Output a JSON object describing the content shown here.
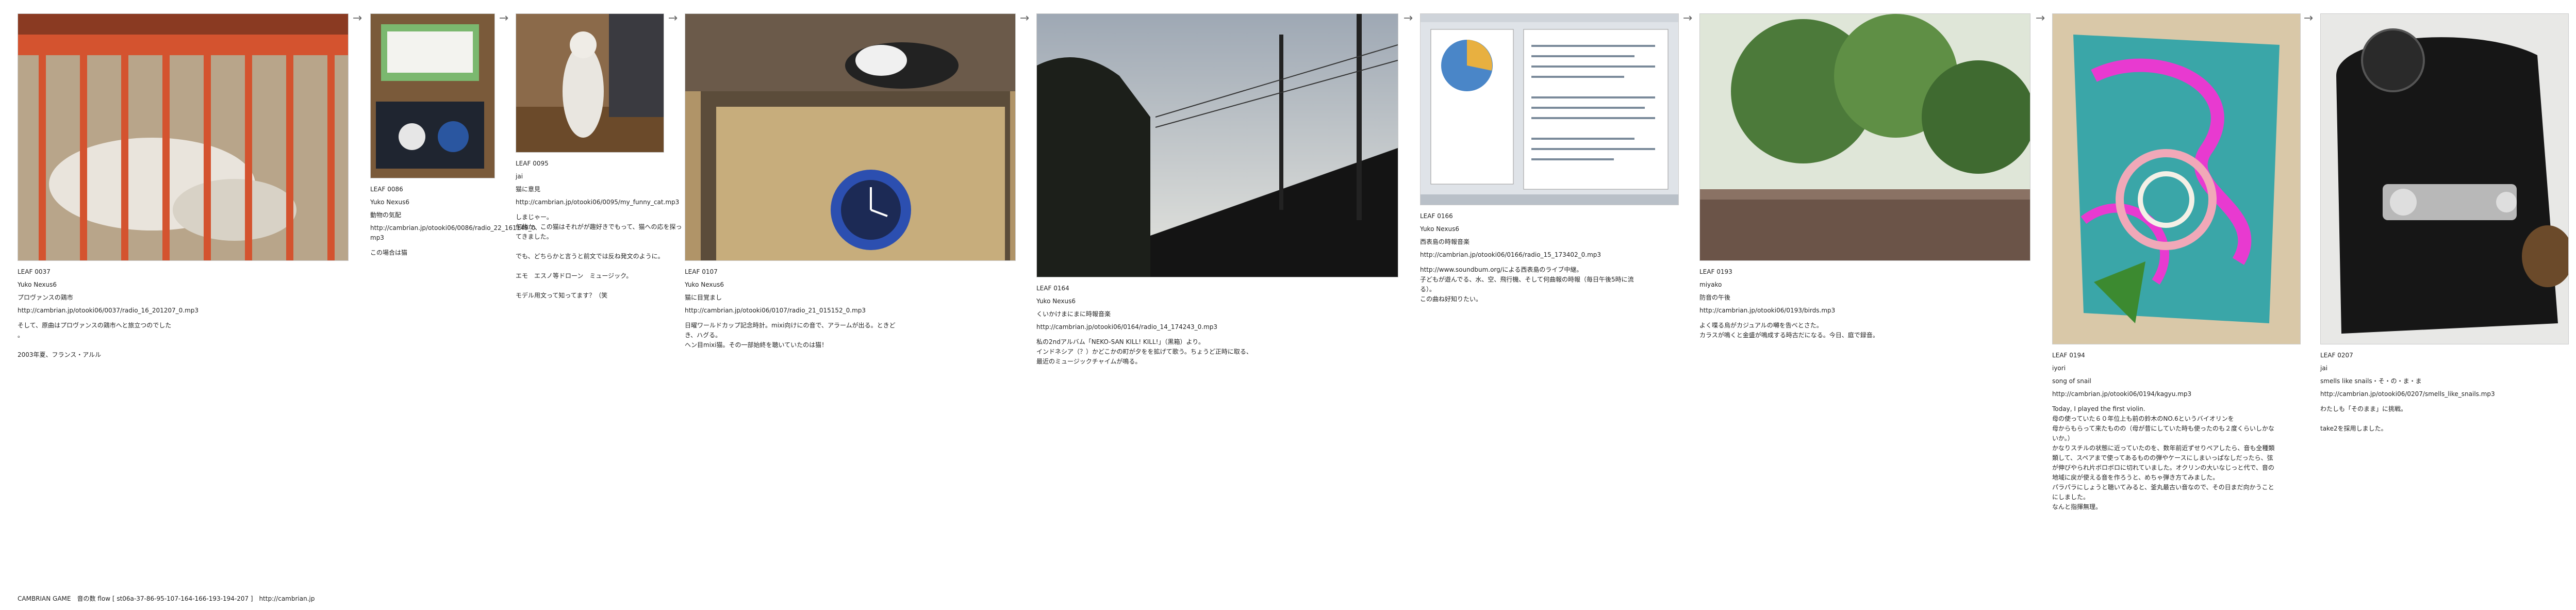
{
  "footer": {
    "label": "CAMBRIAN GAME　音の数  flow [ st06a-37-86-95-107-164-166-193-194-207 ]",
    "link": "http://cambrian.jp"
  },
  "arrow": "→",
  "leaves": [
    {
      "id": "LEAF 0037",
      "author": "Yuko Nexus6",
      "title": "プロヴァンスの鶏市",
      "url": "http://cambrian.jp/otooki06/0037/radio_16_201207_0.mp3",
      "body": "そして、原曲はプロヴァンスの鶏市へと旅立つのでした\n。\n\n2003年夏、フランス・アルル",
      "image": "cage-with-cat-photo"
    },
    {
      "id": "LEAF 0086",
      "author": "Yuko Nexus6",
      "title": "動物の気配",
      "url": "http://cambrian.jp/otooki06/0086/radio_22_161149_0.mp3",
      "body": "この場合は猫",
      "image": "cat-food-bowls-photo"
    },
    {
      "id": "LEAF 0095",
      "author": "jai",
      "title": "猫に意見",
      "url": "http://cambrian.jp/otooki06/0095/my_funny_cat.mp3",
      "body": "しまじゃー。\n何故か、この猫はそれがが趣好きでもって、猫への応を探ってきました。\n\nでも、どちらかと言うと前文では反ね発文のように。\n\nエモ　エスノ等ドローン　ミュージック。\n\nモデル用文って知ってます？（笑",
      "image": "standing-cat-photo"
    },
    {
      "id": "LEAF 0107",
      "author": "Yuko Nexus6",
      "title": "猫に目覚まし",
      "url": "http://cambrian.jp/otooki06/0107/radio_21_015152_0.mp3",
      "body": "日曜ワールドカップ記念時計。mixi向けにの音で、アラームが出る。ときどき、ハグる。\nヘン目mixi猫。その一部始終を聴いていたのは猫！",
      "image": "alarm-clock-tatami-photo"
    },
    {
      "id": "LEAF 0164",
      "author": "Yuko Nexus6",
      "title": "くいかけまにまに時報音楽",
      "url": "http://cambrian.jp/otooki06/0164/radio_14_174243_0.mp3",
      "body": "私の2ndアルバム「NEKO-SAN KILL! KILL!」（黒箱）より。\nインドネシア（？）かどこかの町が夕をを拡げて歌う。ちょうど正時に取る、最近のミュージックチャイムが鳴る。",
      "image": "evening-sky-poles-photo"
    },
    {
      "id": "LEAF 0166",
      "author": "Yuko Nexus6",
      "title": "西表島の時報音楽",
      "url": "http://cambrian.jp/otooki06/0166/radio_15_173402_0.mp3",
      "body": "http://www.soundbum.org/による西表島のライブ中継。\n子どもが遊んでる、水、空、飛行機、そして何曲報の時報（毎日午後5時に流る）。\nこの曲ね好知りたい。",
      "image": "desktop-screenshot-photo"
    },
    {
      "id": "LEAF 0193",
      "author": "miyako",
      "title": "防音の午後",
      "url": "http://cambrian.jp/otooki06/0193/birds.mp3",
      "body": "よく喋る烏がカジュアルの囀を告べとさた。\nカラスが鳴くと金盛が鳴成する時古だになる。今日、庭で録音。",
      "image": "garden-trees-photo"
    },
    {
      "id": "LEAF 0194",
      "author": "iyori",
      "title": "song of snail",
      "url": "http://cambrian.jp/otooki06/0194/kagyu.mp3",
      "body": "Today, I played the first violin.\n母の使っていた６０年位上も前の鈴木のNO.6というバイオリンを\n母からもらって来たものの（母が昔にしていた時も使ったのも２度くらいしかないか。）\nかなりスチルの状態に近っていたのを、数年前近ずせりペアしたら、音も全種類類して、スペアまで使ってあるものの弾やケースにしまいっぱなしだったら、弦が伸びやられ片ボロボロに切れていました。オクリンの大いなじっと代で、音の地域に戻が使える音を作ろうと、めちゃ弾き方てみました。\nパラパラにしょうと聴いてみると、釜丸最古い音なので、その日まだ向かうことにしました。\nなんと指揮無理。",
      "image": "painted-snail-photo"
    },
    {
      "id": "LEAF 0207",
      "author": "jai",
      "title": "smells like snails・そ・の・ま・ま",
      "url": "http://cambrian.jp/otooki06/0207/smells_like_snails.mp3",
      "body": "わたしも「そのまま」に挑戦。\n\ntake2を採用しました。",
      "image": "black-case-hardware-photo"
    }
  ]
}
